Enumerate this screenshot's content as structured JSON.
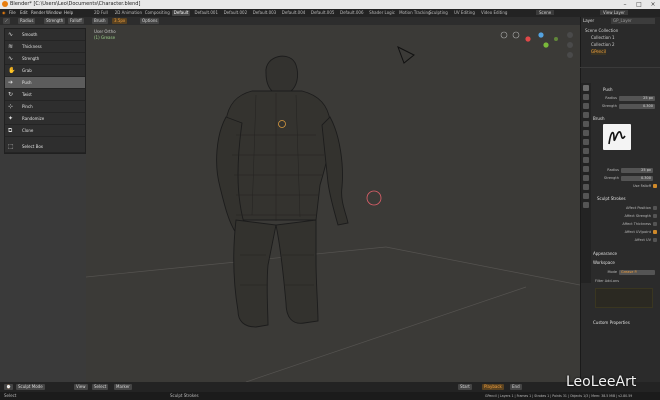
{
  "window": {
    "title": "Blender* [C:\\Users\\Leo\\Documents\\Character.blend]",
    "controls": [
      "–",
      "□",
      "×"
    ]
  },
  "menu": {
    "items": [
      "File",
      "Edit",
      "Render",
      "Window",
      "Help"
    ],
    "workspace_tabs": [
      "2D Full",
      "2D Animation",
      "Compositing",
      "Default",
      "Default.001",
      "Default.002",
      "Default.003",
      "Default.004",
      "Default.005",
      "Default.006",
      "Shader Logic",
      "Motion Tracking",
      "Sculpting",
      "UV Editing",
      "Video Editing"
    ],
    "active_tab": "Default",
    "scene_label": "Scene",
    "layer_label": "View Layer"
  },
  "tool_header": {
    "mode": "Edit Mode",
    "items": [
      "Radius",
      "Strength",
      "Falloff",
      "Brush"
    ],
    "extra": "Options",
    "subitems": [
      "Radius",
      "3.5px"
    ]
  },
  "brushes": [
    {
      "label": "Smooth",
      "icon": "smooth-brush-icon",
      "glyph": "∿"
    },
    {
      "label": "Thickness",
      "icon": "thickness-brush-icon",
      "glyph": "≋"
    },
    {
      "label": "Strength",
      "icon": "strength-brush-icon",
      "glyph": "∿"
    },
    {
      "label": "Grab",
      "icon": "grab-brush-icon",
      "glyph": "✋"
    },
    {
      "label": "Push",
      "icon": "push-brush-icon",
      "glyph": "➔",
      "active": true
    },
    {
      "label": "Twist",
      "icon": "twist-brush-icon",
      "glyph": "↻"
    },
    {
      "label": "Pinch",
      "icon": "pinch-brush-icon",
      "glyph": "⊹"
    },
    {
      "label": "Randomize",
      "icon": "randomize-brush-icon",
      "glyph": "✦"
    },
    {
      "label": "Clone",
      "icon": "clone-brush-icon",
      "glyph": "⧉"
    },
    {
      "label": "Select Box",
      "icon": "select-box-icon",
      "glyph": "⬚"
    }
  ],
  "viewport": {
    "view_name": "User Ortho",
    "object_name": "(1) Grease"
  },
  "outliner": {
    "header": "Layer",
    "search_placeholder": "GP_Layer",
    "rows": [
      {
        "label": "Scene Collection",
        "color": "#d0d0d0"
      },
      {
        "label": "Collection 1",
        "color": "#d0d0d0"
      },
      {
        "label": "Collection 2",
        "color": "#d0d0d0"
      },
      {
        "label": "GPencil",
        "color": "#f0a040"
      }
    ]
  },
  "properties": {
    "tool_name": "Push",
    "radius_label": "Radius",
    "radius_value": "25 px",
    "strength_label": "Strength",
    "strength_value": "0.300",
    "brush_section": "Brush",
    "brush_radius_label": "Radius",
    "brush_radius_value": "25 px",
    "brush_strength_label": "Strength",
    "brush_strength_value": "0.300",
    "use_falloff_label": "Use Falloff",
    "sculpt_strokes_section": "Sculpt Strokes",
    "affect_options": [
      {
        "label": "Affect Position",
        "on": false
      },
      {
        "label": "Affect Strength",
        "on": false
      },
      {
        "label": "Affect Thickness",
        "on": false
      },
      {
        "label": "Affect UV/point",
        "on": true
      },
      {
        "label": "Affect UV",
        "on": false
      }
    ],
    "appearance_section": "Appearance",
    "workspace_section": "Workspace",
    "mode_label": "Mode",
    "mode_value": "Grease P.",
    "filter_add_ons_label": "Filter Add-ons",
    "custom_properties_section": "Custom Properties"
  },
  "timeline": {
    "mode": "Sculpt Mode",
    "items": [
      "View",
      "Select",
      "Marker"
    ],
    "frame_controls": [
      "Start",
      "End"
    ],
    "playback": "Playback"
  },
  "statusbar": {
    "left": "Select",
    "middle": "Sculpt Strokes",
    "right": "GPencil | Layers 1 | Frames 1 | Strokes 1 | Points 31 | Objects 1/3 | Mem: 38.5 MiB | v2.80.59"
  },
  "watermark": "LeoLeeArt",
  "colors": {
    "accent": "#e87d0d",
    "active_brush": "#5c5c5c",
    "mesh_stroke": "#1a1a1a"
  }
}
